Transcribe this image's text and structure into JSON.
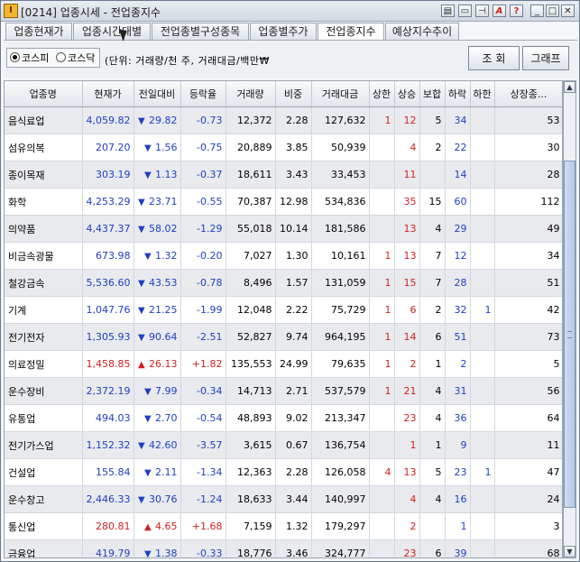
{
  "window": {
    "title": "[0214] 업종시세 - 전업종지수",
    "app_icon_glyph": "I",
    "title_buttons": [
      {
        "name": "layout-icon",
        "glyph": "▤"
      },
      {
        "name": "window-icon",
        "glyph": "▭"
      },
      {
        "name": "pin-icon",
        "glyph": "⊣"
      },
      {
        "name": "font-icon",
        "glyph": "A"
      },
      {
        "name": "help-icon",
        "glyph": "?"
      },
      {
        "name": "minimize-icon",
        "glyph": "_"
      },
      {
        "name": "maximize-icon",
        "glyph": "□"
      },
      {
        "name": "close-icon",
        "glyph": "✕"
      }
    ]
  },
  "tabs": [
    {
      "label": "업종현재가",
      "active": false
    },
    {
      "label": "업종시간대별",
      "active": false
    },
    {
      "label": "전업종별구성종목",
      "active": false
    },
    {
      "label": "업종별주가",
      "active": false
    },
    {
      "label": "전업종지수",
      "active": true
    },
    {
      "label": "예상지수추이",
      "active": false
    }
  ],
  "toolbar": {
    "radio_kospi": "코스피",
    "radio_kosdaq": "코스닥",
    "selected_market": "코스피",
    "unit_text": "(단위: 거래량/천 주, 거래대금/백만₩",
    "query_label": "조  회",
    "chart_label": "그래프"
  },
  "table": {
    "columns": [
      "업종명",
      "현재가",
      "전일대비",
      "등락율",
      "거래량",
      "비중",
      "거래대금",
      "상한",
      "상승",
      "보합",
      "하락",
      "하한",
      "상장종..."
    ],
    "colors": {
      "down": "#1f3fc4",
      "up": "#d42020",
      "neutral": "#000000"
    },
    "rows": [
      {
        "name": "음식료업",
        "price": "4,059.82",
        "dir": "down",
        "change": "29.82",
        "rate": "-0.73",
        "volume": "12,372",
        "share": "2.28",
        "amount": "127,632",
        "upper": "1",
        "rise": "12",
        "flat": "5",
        "fall": "34",
        "lower": "",
        "listed": "53"
      },
      {
        "name": "섬유의복",
        "price": "207.20",
        "dir": "down",
        "change": "1.56",
        "rate": "-0.75",
        "volume": "20,889",
        "share": "3.85",
        "amount": "50,939",
        "upper": "",
        "rise": "4",
        "flat": "2",
        "fall": "22",
        "lower": "",
        "listed": "30"
      },
      {
        "name": "종이목재",
        "price": "303.19",
        "dir": "down",
        "change": "1.13",
        "rate": "-0.37",
        "volume": "18,611",
        "share": "3.43",
        "amount": "33,453",
        "upper": "",
        "rise": "11",
        "flat": "",
        "fall": "14",
        "lower": "",
        "listed": "28"
      },
      {
        "name": "화학",
        "price": "4,253.29",
        "dir": "down",
        "change": "23.71",
        "rate": "-0.55",
        "volume": "70,387",
        "share": "12.98",
        "amount": "534,836",
        "upper": "",
        "rise": "35",
        "flat": "15",
        "fall": "60",
        "lower": "",
        "listed": "112"
      },
      {
        "name": "의약품",
        "price": "4,437.37",
        "dir": "down",
        "change": "58.02",
        "rate": "-1.29",
        "volume": "55,018",
        "share": "10.14",
        "amount": "181,586",
        "upper": "",
        "rise": "13",
        "flat": "4",
        "fall": "29",
        "lower": "",
        "listed": "49"
      },
      {
        "name": "비금속광물",
        "price": "673.98",
        "dir": "down",
        "change": "1.32",
        "rate": "-0.20",
        "volume": "7,027",
        "share": "1.30",
        "amount": "10,161",
        "upper": "1",
        "rise": "13",
        "flat": "7",
        "fall": "12",
        "lower": "",
        "listed": "34"
      },
      {
        "name": "철강금속",
        "price": "5,536.60",
        "dir": "down",
        "change": "43.53",
        "rate": "-0.78",
        "volume": "8,496",
        "share": "1.57",
        "amount": "131,059",
        "upper": "1",
        "rise": "15",
        "flat": "7",
        "fall": "28",
        "lower": "",
        "listed": "51"
      },
      {
        "name": "기계",
        "price": "1,047.76",
        "dir": "down",
        "change": "21.25",
        "rate": "-1.99",
        "volume": "12,048",
        "share": "2.22",
        "amount": "75,729",
        "upper": "1",
        "rise": "6",
        "flat": "2",
        "fall": "32",
        "lower": "1",
        "listed": "42"
      },
      {
        "name": "전기전자",
        "price": "1,305.93",
        "dir": "down",
        "change": "90.64",
        "rate": "-2.51",
        "volume": "52,827",
        "share": "9.74",
        "amount": "964,195",
        "upper": "1",
        "rise": "14",
        "flat": "6",
        "fall": "51",
        "lower": "",
        "listed": "73"
      },
      {
        "name": "의료정밀",
        "price": "1,458.85",
        "dir": "up",
        "change": "26.13",
        "rate": "+1.82",
        "volume": "135,553",
        "share": "24.99",
        "amount": "79,635",
        "upper": "1",
        "rise": "2",
        "flat": "1",
        "fall": "2",
        "lower": "",
        "listed": "5"
      },
      {
        "name": "운수장비",
        "price": "2,372.19",
        "dir": "down",
        "change": "7.99",
        "rate": "-0.34",
        "volume": "14,713",
        "share": "2.71",
        "amount": "537,579",
        "upper": "1",
        "rise": "21",
        "flat": "4",
        "fall": "31",
        "lower": "",
        "listed": "56"
      },
      {
        "name": "유통업",
        "price": "494.03",
        "dir": "down",
        "change": "2.70",
        "rate": "-0.54",
        "volume": "48,893",
        "share": "9.02",
        "amount": "213,347",
        "upper": "",
        "rise": "23",
        "flat": "4",
        "fall": "36",
        "lower": "",
        "listed": "64"
      },
      {
        "name": "전기가스업",
        "price": "1,152.32",
        "dir": "down",
        "change": "42.60",
        "rate": "-3.57",
        "volume": "3,615",
        "share": "0.67",
        "amount": "136,754",
        "upper": "",
        "rise": "1",
        "flat": "1",
        "fall": "9",
        "lower": "",
        "listed": "11"
      },
      {
        "name": "건설업",
        "price": "155.84",
        "dir": "down",
        "change": "2.11",
        "rate": "-1.34",
        "volume": "12,363",
        "share": "2.28",
        "amount": "126,058",
        "upper": "4",
        "rise": "13",
        "flat": "5",
        "fall": "23",
        "lower": "1",
        "listed": "47"
      },
      {
        "name": "운수창고",
        "price": "2,446.33",
        "dir": "down",
        "change": "30.76",
        "rate": "-1.24",
        "volume": "18,633",
        "share": "3.44",
        "amount": "140,997",
        "upper": "",
        "rise": "4",
        "flat": "4",
        "fall": "16",
        "lower": "",
        "listed": "24"
      },
      {
        "name": "통신업",
        "price": "280.81",
        "dir": "up",
        "change": "4.65",
        "rate": "+1.68",
        "volume": "7,159",
        "share": "1.32",
        "amount": "179,297",
        "upper": "",
        "rise": "2",
        "flat": "",
        "fall": "1",
        "lower": "",
        "listed": "3"
      },
      {
        "name": "금융업",
        "price": "419.79",
        "dir": "down",
        "change": "1.38",
        "rate": "-0.33",
        "volume": "18,776",
        "share": "3.46",
        "amount": "324,777",
        "upper": "",
        "rise": "23",
        "flat": "6",
        "fall": "39",
        "lower": "",
        "listed": "68"
      }
    ]
  },
  "scrollbar": {
    "up_glyph": "▲",
    "down_glyph": "▼"
  }
}
